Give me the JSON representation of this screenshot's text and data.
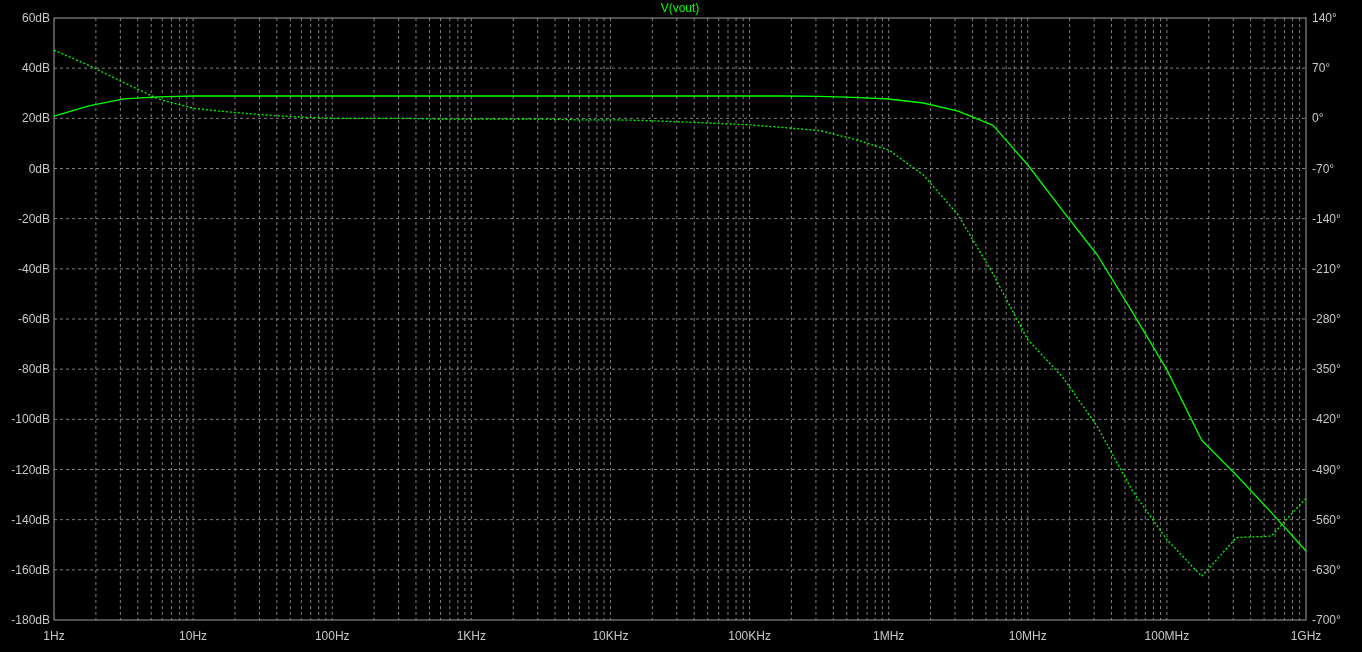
{
  "plot": {
    "chart_data": [
      {
        "type": "line",
        "title": "V(vout)",
        "grid": true,
        "categories": [
          "1Hz",
          null,
          null,
          null,
          "10Hz",
          null,
          null,
          null,
          "100Hz",
          null,
          null,
          null,
          "1KHz",
          null,
          null,
          null,
          "10KHz",
          null,
          null,
          null,
          "100KHz",
          null,
          null,
          null,
          "1MHz",
          null,
          null,
          null,
          "10MHz",
          null,
          null,
          null,
          "100MHz",
          null,
          null,
          null,
          "1GHz"
        ],
        "series": [
          {
            "color": "#00ff00",
            "line_style": "solid",
            "values": [
              20.9,
              25,
              27.8,
              28.6,
              28.9,
              28.9,
              28.9,
              28.9,
              28.9,
              28.9,
              28.9,
              28.9,
              28.9,
              28.9,
              28.9,
              28.9,
              28.9,
              28.9,
              28.9,
              28.9,
              28.9,
              28.9,
              28.8,
              28.4,
              27.7,
              26.1,
              22.9,
              17.2,
              1.4,
              -16.8,
              -34.5,
              -57.1,
              -80.3,
              -108.3,
              -122.3,
              -137.1,
              -152.5
            ]
          }
        ],
        "ylim": [
          -180,
          60
        ],
        "yticks": [
          {
            "value": 60,
            "label": "60dB"
          },
          {
            "value": 40,
            "label": "40dB"
          },
          {
            "value": 20,
            "label": "20dB"
          },
          {
            "value": 0,
            "label": "0dB"
          },
          {
            "value": -20,
            "label": "-20dB"
          },
          {
            "value": -40,
            "label": "-40dB"
          },
          {
            "value": -60,
            "label": "-60dB"
          },
          {
            "value": -80,
            "label": "-80dB"
          },
          {
            "value": -100,
            "label": "-100dB"
          },
          {
            "value": -120,
            "label": "-120dB"
          },
          {
            "value": -140,
            "label": "-140dB"
          },
          {
            "value": -160,
            "label": "-160dB"
          },
          {
            "value": -180,
            "label": "-180dB"
          }
        ]
      },
      {
        "type": "line",
        "categories": [
          null,
          null,
          null,
          null,
          null,
          null,
          null,
          null,
          null,
          null,
          null,
          null,
          null,
          null,
          null,
          null,
          null,
          null,
          null,
          null,
          null,
          null,
          null,
          null,
          null,
          null,
          null,
          null,
          null,
          null,
          null,
          null,
          null,
          null,
          null,
          null,
          null
        ],
        "series": [
          {
            "color": "#00ff00",
            "line_style": "dotted",
            "values": [
              95,
              74,
              50,
              27,
              14,
              9,
              5,
              2,
              0,
              0,
              0,
              -1,
              -1,
              -1,
              -1,
              -2,
              -2,
              -3,
              -5,
              -7,
              -9,
              -13,
              -17,
              -29,
              -44,
              -79,
              -135,
              -217,
              -309,
              -361,
              -430,
              -519,
              -588,
              -639,
              -585,
              -583,
              -530
            ]
          }
        ],
        "ylim": [
          -700,
          140
        ],
        "yticks": [
          {
            "value": 140,
            "label": "140°"
          },
          {
            "value": 70,
            "label": "70°"
          },
          {
            "value": 0,
            "label": "0°"
          },
          {
            "value": -70,
            "label": "-70°"
          },
          {
            "value": -140,
            "label": "-140°"
          },
          {
            "value": -210,
            "label": "-210°"
          },
          {
            "value": -280,
            "label": "-280°"
          },
          {
            "value": -350,
            "label": "-350°"
          },
          {
            "value": -420,
            "label": "-420°"
          },
          {
            "value": -490,
            "label": "-490°"
          },
          {
            "value": -560,
            "label": "-560°"
          },
          {
            "value": -630,
            "label": "-630°"
          },
          {
            "value": -700,
            "label": "-700°"
          }
        ]
      }
    ]
  }
}
